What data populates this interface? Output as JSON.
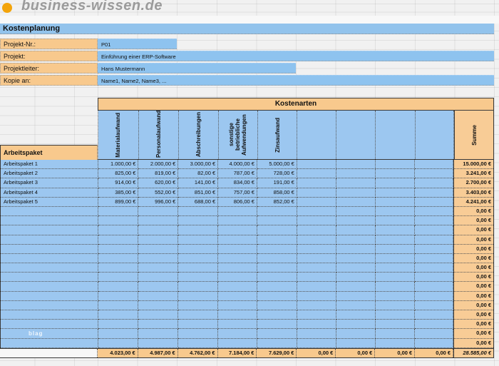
{
  "logo": {
    "brand": "business-wissen.de"
  },
  "sheet": {
    "title": "Kostenplanung"
  },
  "form": {
    "fields": [
      {
        "label": "Projekt-Nr.:",
        "value": "P01"
      },
      {
        "label": "Projekt:",
        "value": "Einführung einer ERP-Software"
      },
      {
        "label": "Projektleiter:",
        "value": "Hans Mustermann"
      },
      {
        "label": "Kopie an:",
        "value": "Name1, Name2, Name3, ..."
      }
    ]
  },
  "table": {
    "group_header": "Kostenarten",
    "row_header": "Arbeitspaket",
    "columns": [
      "Materialaufwand",
      "Personalaufwand",
      "Abschreibungen",
      "sonstige betriebliche Aufwendungen",
      "Zinsaufwand",
      "",
      "",
      "",
      ""
    ],
    "sum_header": "Summe",
    "rows": [
      {
        "name": "Arbeitspaket 1",
        "values": [
          "1.000,00 €",
          "2.000,00 €",
          "3.000,00 €",
          "4.000,00 €",
          "5.000,00 €",
          "",
          "",
          "",
          ""
        ],
        "sum": "15.000,00 €"
      },
      {
        "name": "Arbeitspaket 2",
        "values": [
          "825,00 €",
          "819,00 €",
          "82,00 €",
          "787,00 €",
          "728,00 €",
          "",
          "",
          "",
          ""
        ],
        "sum": "3.241,00 €"
      },
      {
        "name": "Arbeitspaket 3",
        "values": [
          "914,00 €",
          "620,00 €",
          "141,00 €",
          "834,00 €",
          "191,00 €",
          "",
          "",
          "",
          ""
        ],
        "sum": "2.700,00 €"
      },
      {
        "name": "Arbeitspaket 4",
        "values": [
          "385,00 €",
          "552,00 €",
          "851,00 €",
          "757,00 €",
          "858,00 €",
          "",
          "",
          "",
          ""
        ],
        "sum": "3.403,00 €"
      },
      {
        "name": "Arbeitspaket 5",
        "values": [
          "899,00 €",
          "996,00 €",
          "688,00 €",
          "806,00 €",
          "852,00 €",
          "",
          "",
          "",
          ""
        ],
        "sum": "4.241,00 €"
      },
      {
        "name": "",
        "values": [
          "",
          "",
          "",
          "",
          "",
          "",
          "",
          "",
          ""
        ],
        "sum": "0,00 €"
      },
      {
        "name": "",
        "values": [
          "",
          "",
          "",
          "",
          "",
          "",
          "",
          "",
          ""
        ],
        "sum": "0,00 €"
      },
      {
        "name": "",
        "values": [
          "",
          "",
          "",
          "",
          "",
          "",
          "",
          "",
          ""
        ],
        "sum": "0,00 €"
      },
      {
        "name": "",
        "values": [
          "",
          "",
          "",
          "",
          "",
          "",
          "",
          "",
          ""
        ],
        "sum": "0,00 €"
      },
      {
        "name": "",
        "values": [
          "",
          "",
          "",
          "",
          "",
          "",
          "",
          "",
          ""
        ],
        "sum": "0,00 €"
      },
      {
        "name": "",
        "values": [
          "",
          "",
          "",
          "",
          "",
          "",
          "",
          "",
          ""
        ],
        "sum": "0,00 €"
      },
      {
        "name": "",
        "values": [
          "",
          "",
          "",
          "",
          "",
          "",
          "",
          "",
          ""
        ],
        "sum": "0,00 €"
      },
      {
        "name": "",
        "values": [
          "",
          "",
          "",
          "",
          "",
          "",
          "",
          "",
          ""
        ],
        "sum": "0,00 €"
      },
      {
        "name": "",
        "values": [
          "",
          "",
          "",
          "",
          "",
          "",
          "",
          "",
          ""
        ],
        "sum": "0,00 €"
      },
      {
        "name": "",
        "values": [
          "",
          "",
          "",
          "",
          "",
          "",
          "",
          "",
          ""
        ],
        "sum": "0,00 €"
      },
      {
        "name": "",
        "values": [
          "",
          "",
          "",
          "",
          "",
          "",
          "",
          "",
          ""
        ],
        "sum": "0,00 €"
      },
      {
        "name": "",
        "values": [
          "",
          "",
          "",
          "",
          "",
          "",
          "",
          "",
          ""
        ],
        "sum": "0,00 €"
      },
      {
        "name": "",
        "values": [
          "",
          "",
          "",
          "",
          "",
          "",
          "",
          "",
          ""
        ],
        "sum": "0,00 €"
      },
      {
        "name": "",
        "values": [
          "",
          "",
          "",
          "",
          "",
          "",
          "",
          "",
          ""
        ],
        "sum": "0,00 €"
      },
      {
        "name": "",
        "values": [
          "",
          "",
          "",
          "",
          "",
          "",
          "",
          "",
          ""
        ],
        "sum": "0,00 €"
      }
    ],
    "totals": {
      "values": [
        "4.023,00 €",
        "4.987,00 €",
        "4.762,00 €",
        "7.184,00 €",
        "7.629,00 €",
        "0,00 €",
        "0,00 €",
        "0,00 €",
        "0,00 €"
      ],
      "grand_total": "28.585,00 €"
    },
    "watermark": "blag"
  },
  "colors": {
    "accent_orange": "#f8c98d",
    "sum_orange": "#f8cc96",
    "field_blue": "#8ec3ef",
    "cell_blue": "#9cc7f0",
    "title_blue": "#92c3ec",
    "logo_orange": "#f3a40a"
  }
}
